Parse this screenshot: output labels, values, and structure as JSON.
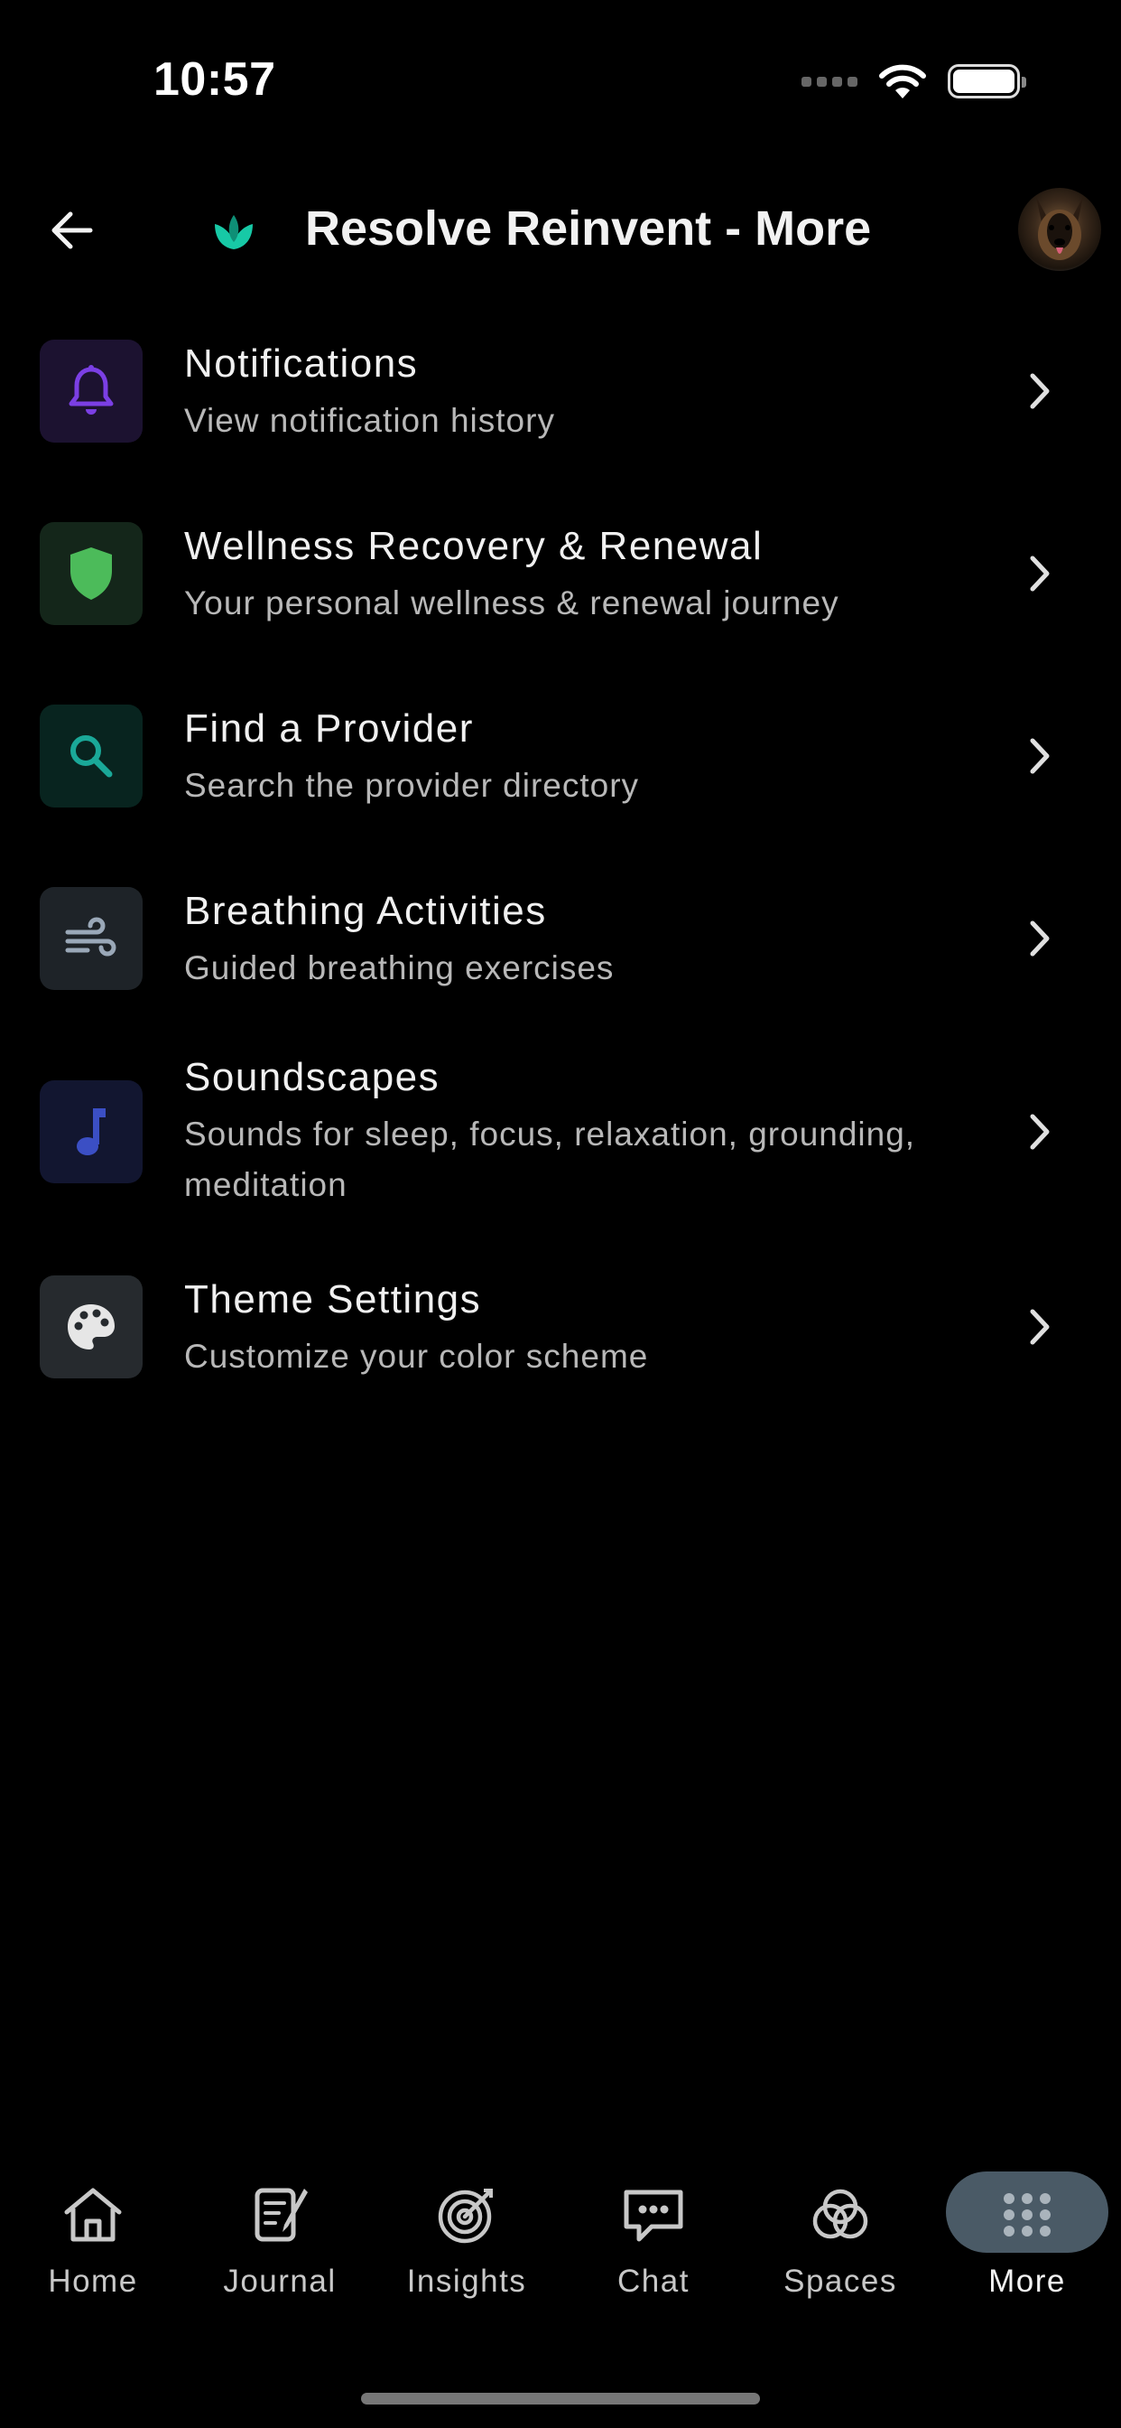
{
  "status_bar": {
    "time": "10:57"
  },
  "header": {
    "title": "Resolve Reinvent - More",
    "back_icon": "arrow-left-icon",
    "logo_icon": "lotus-icon",
    "avatar": "user-avatar"
  },
  "menu": {
    "items": [
      {
        "title": "Notifications",
        "subtitle": "View notification history",
        "icon": "bell-icon",
        "icon_color": "#7b3fe4",
        "tile_color": "#1c1230"
      },
      {
        "title": "Wellness Recovery & Renewal",
        "subtitle": "Your personal wellness & renewal journey",
        "icon": "shield-icon",
        "icon_color": "#4cbb5a",
        "tile_color": "#14261a"
      },
      {
        "title": "Find a Provider",
        "subtitle": "Search the provider directory",
        "icon": "search-icon",
        "icon_color": "#1aa898",
        "tile_color": "#08241f"
      },
      {
        "title": "Breathing Activities",
        "subtitle": "Guided breathing exercises",
        "icon": "wind-icon",
        "icon_color": "#9aa8b8",
        "tile_color": "#1e2328"
      },
      {
        "title": "Soundscapes",
        "subtitle": "Sounds for sleep, focus, relaxation, grounding, meditation",
        "icon": "music-note-icon",
        "icon_color": "#3b4fc4",
        "tile_color": "#121630"
      },
      {
        "title": "Theme Settings",
        "subtitle": "Customize your color scheme",
        "icon": "palette-icon",
        "icon_color": "#e6e6e6",
        "tile_color": "#262a2e"
      }
    ]
  },
  "tabbar": {
    "tabs": [
      {
        "label": "Home",
        "icon": "home-icon"
      },
      {
        "label": "Journal",
        "icon": "journal-icon"
      },
      {
        "label": "Insights",
        "icon": "target-icon"
      },
      {
        "label": "Chat",
        "icon": "chat-bubble-icon"
      },
      {
        "label": "Spaces",
        "icon": "spaces-icon"
      },
      {
        "label": "More",
        "icon": "grid-dots-icon",
        "active": true
      }
    ],
    "active_color": "#4a5a66"
  }
}
